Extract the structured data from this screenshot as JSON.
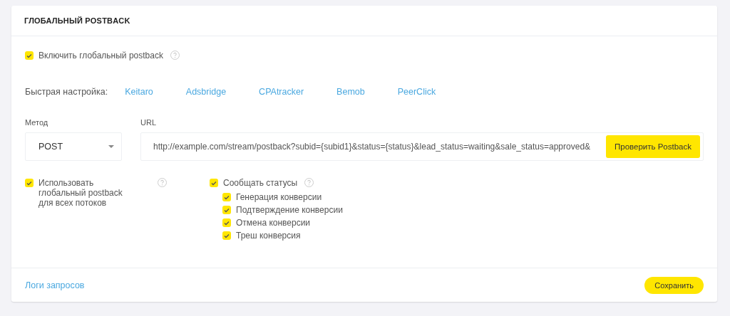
{
  "card": {
    "title": "ГЛОБАЛЬНЫЙ POSTBACK"
  },
  "enable": {
    "label": "Включить глобальный postback",
    "checked": true
  },
  "quick_setup": {
    "label": "Быстрая настройка:",
    "links": [
      "Keitaro",
      "Adsbridge",
      "CPAtracker",
      "Bemob",
      "PeerClick"
    ]
  },
  "method": {
    "label": "Метод",
    "value": "POST"
  },
  "url": {
    "label": "URL",
    "value": "http://example.com/stream/postback?subid={subid1}&status={status}&lead_status=waiting&sale_status=approved&",
    "button": "Проверить Postback"
  },
  "use_for_all": {
    "label": "Использовать глобальный postback для всех потоков",
    "checked": true
  },
  "report_statuses": {
    "label": "Сообщать статусы",
    "checked": true,
    "children": [
      {
        "label": "Генерация конверсии",
        "checked": true
      },
      {
        "label": "Подтверждение конверсии",
        "checked": true
      },
      {
        "label": "Отмена конверсии",
        "checked": true
      },
      {
        "label": "Треш конверсия",
        "checked": true
      }
    ]
  },
  "footer": {
    "link": "Логи запросов",
    "save": "Сохранить"
  }
}
